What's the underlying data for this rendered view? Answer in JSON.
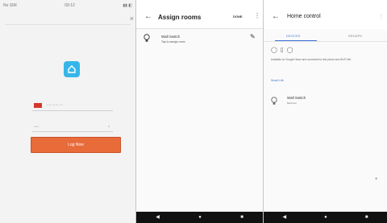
{
  "login_screen": {
    "status_left": "No SIM",
    "status_time": "09:12",
    "close_symbol": "×",
    "phone_text": "•••• •••••• •••",
    "password_text": "••••••",
    "password_toggle": "o",
    "login_label": "Log Now"
  },
  "assign_rooms": {
    "title": "Assign rooms",
    "done_label": "DONE",
    "menu_symbol": "⋮",
    "device": {
      "name": "Wall Switch",
      "subtitle": "Tap to assign room"
    }
  },
  "home_control": {
    "title": "Home control",
    "menu_symbol": "⋮",
    "tabs": [
      "DEVICES",
      "GROUPS"
    ],
    "type_icons": "◯ ▯ ◯",
    "info_text": "Available on Google Home and connected to this phone and Wi-Fi Net",
    "smart_life_link": "Smart Life",
    "device": {
      "name": "Wall Switch",
      "subtitle": "Bedroom"
    },
    "fab_symbol": "+"
  },
  "navbar": {
    "back": "◀",
    "home": "●",
    "recents": "■"
  },
  "colors": {
    "accent_blue": "#3b70d8",
    "login_orange": "#e86b3a",
    "logo_blue": "#36b6e8",
    "flag_red": "#d5372a"
  }
}
